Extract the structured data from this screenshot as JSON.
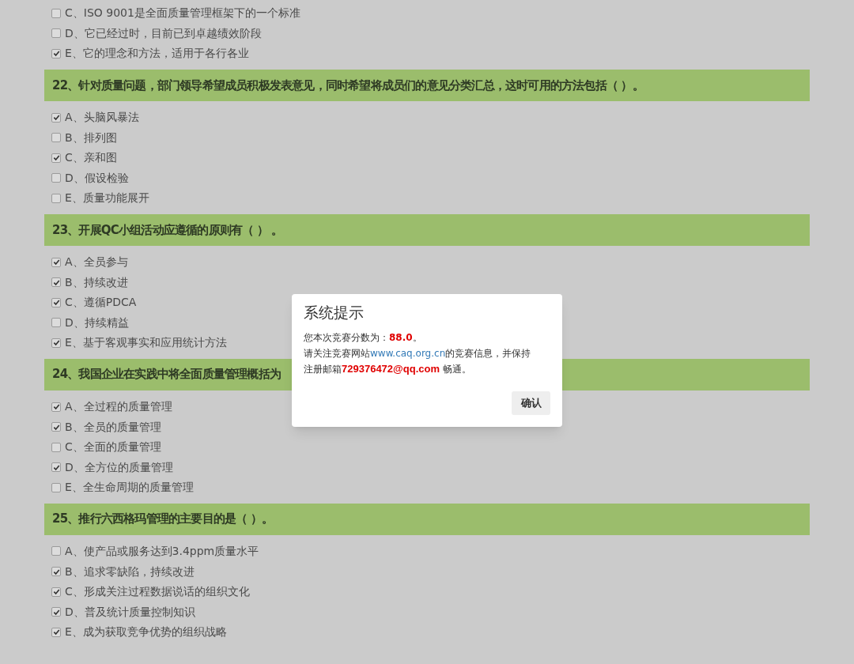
{
  "questions": [
    {
      "options": [
        {
          "label": "C、ISO 9001是全面质量管理框架下的一个标准",
          "checked": false
        },
        {
          "label": "D、它已经过时，目前已到卓越绩效阶段",
          "checked": false
        },
        {
          "label": "E、它的理念和方法，适用于各行各业",
          "checked": true
        }
      ]
    },
    {
      "title": "22、针对质量问题，部门领导希望成员积极发表意见，同时希望将成员们的意见分类汇总，这时可用的方法包括（ ）。",
      "options": [
        {
          "label": "A、头脑风暴法",
          "checked": true
        },
        {
          "label": "B、排列图",
          "checked": false
        },
        {
          "label": "C、亲和图",
          "checked": true
        },
        {
          "label": "D、假设检验",
          "checked": false
        },
        {
          "label": "E、质量功能展开",
          "checked": false
        }
      ]
    },
    {
      "title": "23、开展QC小组活动应遵循的原则有（ ） 。",
      "options": [
        {
          "label": "A、全员参与",
          "checked": true
        },
        {
          "label": "B、持续改进",
          "checked": true
        },
        {
          "label": "C、遵循PDCA",
          "checked": true
        },
        {
          "label": "D、持续精益",
          "checked": false
        },
        {
          "label": "E、基于客观事实和应用统计方法",
          "checked": true
        }
      ]
    },
    {
      "title": "24、我国企业在实践中将全面质量管理概括为",
      "options": [
        {
          "label": "A、全过程的质量管理",
          "checked": true
        },
        {
          "label": "B、全员的质量管理",
          "checked": true
        },
        {
          "label": "C、全面的质量管理",
          "checked": false
        },
        {
          "label": "D、全方位的质量管理",
          "checked": true
        },
        {
          "label": "E、全生命周期的质量管理",
          "checked": false
        }
      ]
    },
    {
      "title": "25、推行六西格玛管理的主要目的是（ ）。",
      "options": [
        {
          "label": "A、使产品或服务达到3.4ppm质量水平",
          "checked": false
        },
        {
          "label": "B、追求零缺陷，持续改进",
          "checked": true
        },
        {
          "label": "C、形成关注过程数据说话的组织文化",
          "checked": true
        },
        {
          "label": "D、普及统计质量控制知识",
          "checked": true
        },
        {
          "label": "E、成为获取竞争优势的组织战略",
          "checked": true
        }
      ]
    }
  ],
  "dialog": {
    "title": "系统提示",
    "score_prefix": "您本次竞赛分数为：",
    "score": "88.0",
    "score_suffix": "。",
    "notice_prefix": "请关注竞赛网站",
    "website": "www.caq.org.cn",
    "notice_middle": "的竞赛信息，并保持注册邮箱",
    "email": "729376472@qq.com",
    "notice_suffix": " 畅通。",
    "button": "确认"
  }
}
